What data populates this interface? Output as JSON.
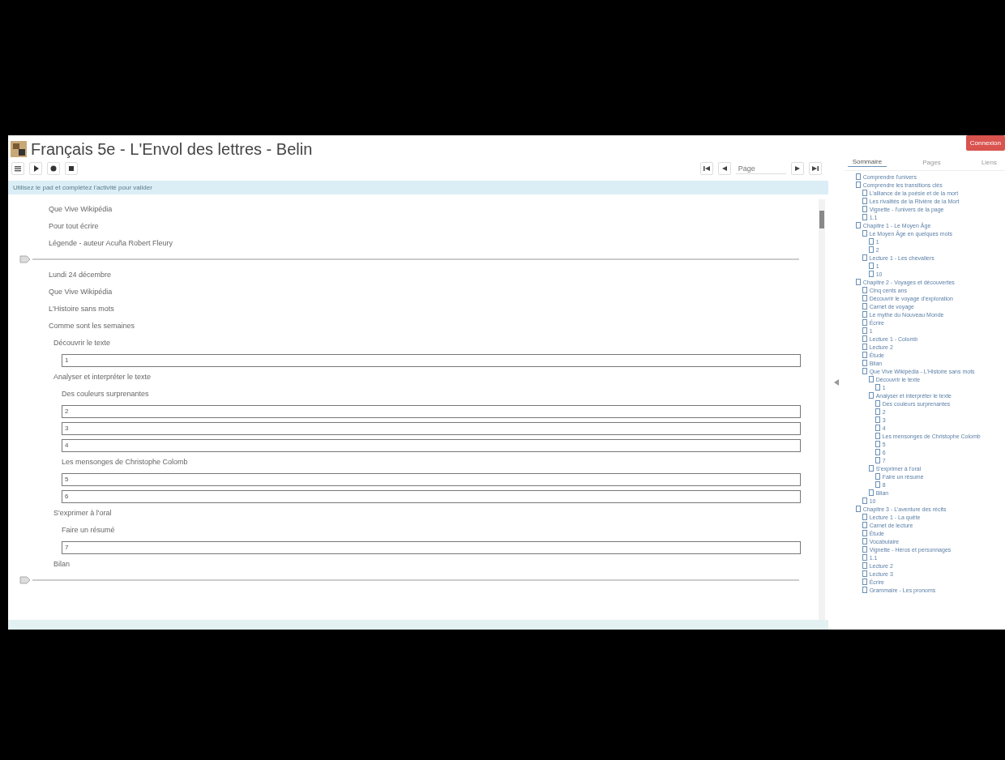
{
  "window": {
    "title": "Français 5e - L'Envol des lettres - Belin"
  },
  "toolbar": {
    "buttons": [
      {
        "kind": "menu"
      },
      {
        "kind": "play"
      },
      {
        "kind": "record"
      },
      {
        "kind": "stop"
      }
    ]
  },
  "navigation": {
    "page_placeholder": "Page"
  },
  "info_bar": "Utilisez le pad et complétez l'activité pour valider",
  "content": [
    {
      "kind": "text",
      "text": "Que Vive Wikipédia"
    },
    {
      "kind": "text",
      "text": "Pour tout écrire"
    },
    {
      "kind": "text",
      "text": "Légende - auteur Acuña Robert Fleury"
    },
    {
      "kind": "rule"
    },
    {
      "kind": "text",
      "text": "Lundi 24 décembre"
    },
    {
      "kind": "text",
      "text": "Que Vive Wikipédia"
    },
    {
      "kind": "text",
      "text": "L'Histoire sans mots"
    },
    {
      "kind": "text",
      "text": "Comme sont les semaines"
    },
    {
      "kind": "section",
      "text": "Découvrir le texte"
    },
    {
      "kind": "field",
      "value": "1"
    },
    {
      "kind": "section",
      "text": "Analyser et interpréter le texte"
    },
    {
      "kind": "subsection",
      "text": "Des couleurs surprenantes"
    },
    {
      "kind": "field",
      "value": "2"
    },
    {
      "kind": "field",
      "value": "3"
    },
    {
      "kind": "field",
      "value": "4"
    },
    {
      "kind": "subsection",
      "text": "Les mensonges de Christophe Colomb"
    },
    {
      "kind": "field",
      "value": "5"
    },
    {
      "kind": "field",
      "value": "6"
    },
    {
      "kind": "section",
      "text": "S'exprimer à l'oral"
    },
    {
      "kind": "subsection",
      "text": "Faire un résumé"
    },
    {
      "kind": "field",
      "value": "7"
    },
    {
      "kind": "section",
      "text": "Bilan"
    },
    {
      "kind": "rule"
    }
  ],
  "sidebar": {
    "login_button": "Connexion",
    "tabs": [
      {
        "label": "Sommaire",
        "selected": true
      },
      {
        "label": "Pages",
        "selected": false
      },
      {
        "label": "Liens",
        "selected": false
      }
    ],
    "tree": [
      {
        "label": "Comprendre l'univers"
      },
      {
        "label": "Comprendre les transitions clés",
        "children": [
          {
            "label": "L'alliance de la poésie et de la mort"
          },
          {
            "label": "Les rivalités de la Rivière de la Mort"
          },
          {
            "label": "Vignette - l'univers de la page"
          },
          {
            "label": "1.1"
          }
        ]
      },
      {
        "label": "Chapitre 1 - Le Moyen Âge",
        "children": [
          {
            "label": "Le Moyen Âge en quelques mots",
            "children": [
              {
                "label": "1"
              },
              {
                "label": "2"
              }
            ]
          },
          {
            "label": "Lecture 1 - Les chevaliers",
            "children": [
              {
                "label": "1"
              },
              {
                "label": "10"
              }
            ]
          }
        ]
      },
      {
        "label": "Chapitre 2 - Voyages et découvertes",
        "children": [
          {
            "label": "Cinq cents ans"
          },
          {
            "label": "Découvrir le voyage d'exploration"
          },
          {
            "label": "Carnet de voyage"
          },
          {
            "label": "Le mythe du Nouveau Monde"
          },
          {
            "label": "Écrire"
          },
          {
            "label": "1"
          },
          {
            "label": "Lecture 1 - Colomb"
          },
          {
            "label": "Lecture 2"
          },
          {
            "label": "Étude"
          },
          {
            "label": "Bilan"
          },
          {
            "label": "Que Vive Wikipédia - L'Histoire sans mots",
            "children": [
              {
                "label": "Découvrir le texte",
                "children": [
                  {
                    "label": "1"
                  }
                ]
              },
              {
                "label": "Analyser et interpréter le texte",
                "children": [
                  {
                    "label": "Des couleurs surprenantes"
                  },
                  {
                    "label": "2"
                  },
                  {
                    "label": "3"
                  },
                  {
                    "label": "4"
                  },
                  {
                    "label": "Les mensonges de Christophe Colomb"
                  },
                  {
                    "label": "5"
                  },
                  {
                    "label": "6"
                  },
                  {
                    "label": "7"
                  }
                ]
              },
              {
                "label": "S'exprimer à l'oral",
                "children": [
                  {
                    "label": "Faire un résumé"
                  },
                  {
                    "label": "8"
                  }
                ]
              },
              {
                "label": "Bilan"
              }
            ]
          },
          {
            "label": "10"
          }
        ]
      },
      {
        "label": "Chapitre 3 - L'aventure des récits",
        "children": [
          {
            "label": "Lecture 1 - La quête"
          },
          {
            "label": "Carnet de lecture"
          },
          {
            "label": "Étude"
          },
          {
            "label": "Vocabulaire"
          },
          {
            "label": "Vignette - Héros et personnages"
          },
          {
            "label": "1.1"
          },
          {
            "label": "Lecture 2"
          },
          {
            "label": "Lecture 3"
          },
          {
            "label": "Écrire"
          },
          {
            "label": "Grammaire - Les pronoms"
          }
        ]
      }
    ]
  }
}
